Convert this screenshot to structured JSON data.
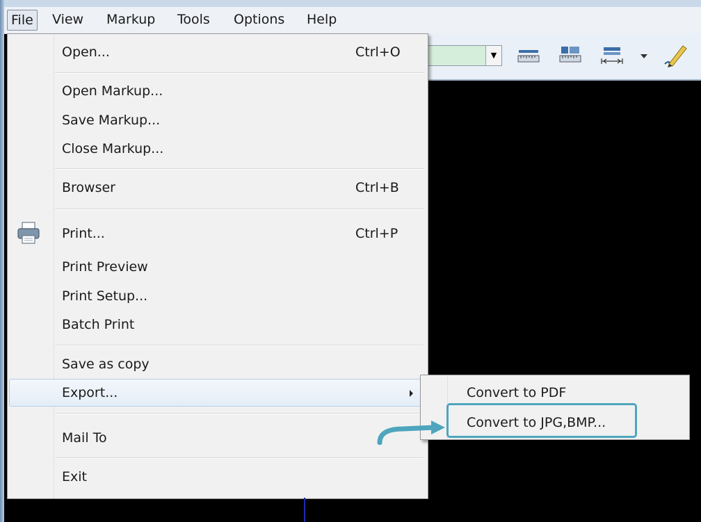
{
  "menubar": {
    "items": [
      "File",
      "View",
      "Markup",
      "Tools",
      "Options",
      "Help"
    ]
  },
  "file_menu": {
    "open": {
      "label": "Open...",
      "shortcut": "Ctrl+O"
    },
    "open_markup": {
      "label": "Open Markup..."
    },
    "save_markup": {
      "label": "Save Markup..."
    },
    "close_markup": {
      "label": "Close Markup..."
    },
    "browser": {
      "label": "Browser",
      "shortcut": "Ctrl+B"
    },
    "print": {
      "label": "Print...",
      "shortcut": "Ctrl+P",
      "icon": "printer-icon"
    },
    "print_preview": {
      "label": "Print Preview"
    },
    "print_setup": {
      "label": "Print Setup..."
    },
    "batch_print": {
      "label": "Batch Print"
    },
    "save_as_copy": {
      "label": "Save as copy"
    },
    "export": {
      "label": "Export..."
    },
    "mail_to": {
      "label": "Mail To"
    },
    "exit": {
      "label": "Exit"
    }
  },
  "export_submenu": {
    "items": [
      "Convert to PDF",
      "Convert to JPG,BMP..."
    ],
    "highlighted": "Convert to JPG,BMP..."
  },
  "toolbar": {
    "icons": [
      "measure-distance-icon",
      "measure-area-icon",
      "measure-length-icon",
      "dropdown-arrow-icon",
      "pencil-icon"
    ]
  },
  "colors": {
    "highlight_border": "#4ea5bd",
    "canvas_background": "#000000",
    "combo_fill": "#d5eedc"
  }
}
